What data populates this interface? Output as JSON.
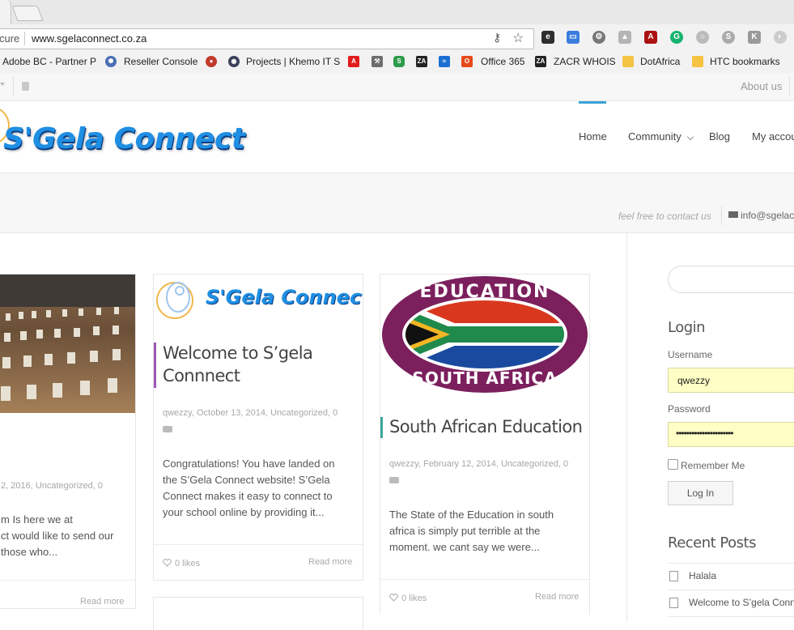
{
  "browser": {
    "secure_label": "cure",
    "url": "www.sgelaconnect.co.za",
    "bookmarks": [
      {
        "label": "Adobe BC - Partner P"
      },
      {
        "label": "Reseller Console"
      },
      {
        "label": "Projects | Khemo IT S"
      },
      {
        "label": "Office 365"
      },
      {
        "label": "ZACR WHOIS"
      },
      {
        "label": "DotAfrica"
      },
      {
        "label": "HTC bookmarks"
      }
    ]
  },
  "topbar": {
    "about": "About us"
  },
  "header": {
    "logo": "S'Gela Connect",
    "nav": {
      "home": "Home",
      "community": "Community",
      "blog": "Blog",
      "account": "My accou"
    }
  },
  "contact": {
    "tagline": "feel free to contact us",
    "email": "info@sgelac"
  },
  "posts": {
    "left": {
      "meta": "2, 2016, Uncategorized, 0",
      "excerpt_lines": [
        "m Is here we at",
        "ct would like to send our",
        "those who..."
      ],
      "readmore": "Read more"
    },
    "middle": {
      "image_text": "S'Gela Connect",
      "title_lines": [
        "Welcome to S’gela",
        "Connnect"
      ],
      "meta_line1": "qwezzy, October 13, 2014, Uncategorized, 0",
      "excerpt_lines": [
        "Congratulations! You have landed on",
        "the S’Gela Connect website!  S’Gela",
        "Connect  makes it easy to connect to",
        "your school online by providing it..."
      ],
      "likes": "0 likes",
      "readmore": "Read more"
    },
    "right": {
      "badge_top": "EDUCATION",
      "badge_bottom": "SOUTH AFRICA",
      "title": "South African Education",
      "meta_line1": "qwezzy, February 12, 2014, Uncategorized, 0",
      "excerpt_lines": [
        "The State of the Education in south",
        "africa  is simply put terrible at the",
        "moment. we cant say we were..."
      ],
      "likes": "0 likes",
      "readmore": "Read more"
    }
  },
  "sidebar": {
    "login_heading": "Login",
    "username_label": "Username",
    "username_value": "qwezzy",
    "password_label": "Password",
    "password_value": "••••••••••••••••••••••",
    "remember_label": "Remember Me",
    "login_button": "Log In",
    "recent_heading": "Recent Posts",
    "recent": [
      "Halala",
      "Welcome to S’gela Conn"
    ]
  },
  "colors": {
    "accent": "#3aa0d7",
    "field_bg": "#ffffc5",
    "title_bar_purple": "#9b59b6",
    "title_bar_teal": "#3aa89a"
  }
}
